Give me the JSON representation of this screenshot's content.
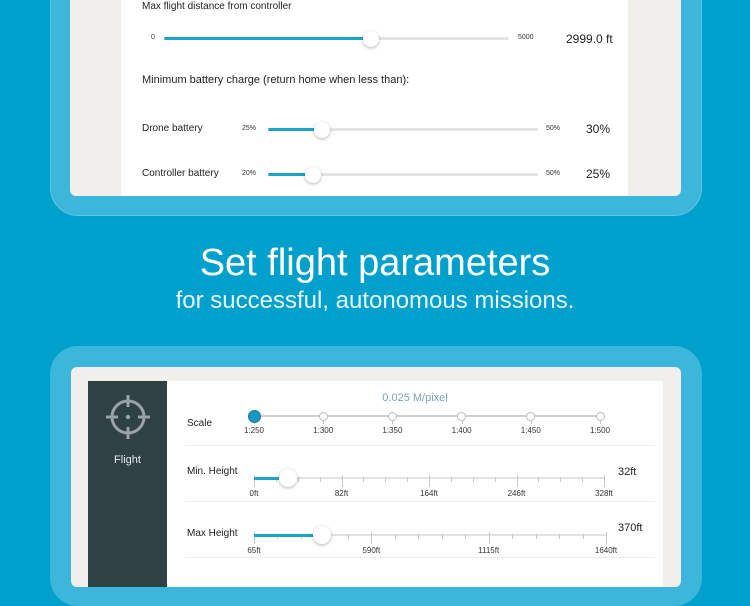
{
  "top_screen": {
    "max_distance": {
      "label": "Max flight distance from controller",
      "min_label": "0",
      "max_label": "5000",
      "min": 0,
      "max": 5000,
      "value": 2999,
      "value_text": "2999.0 ft"
    },
    "battery_heading": "Minimum battery charge (return home when less than):",
    "drone_battery": {
      "label": "Drone battery",
      "min_label": "25%",
      "max_label": "50%",
      "min": 25,
      "max": 50,
      "value": 30,
      "value_text": "30%"
    },
    "controller_battery": {
      "label": "Controller battery",
      "min_label": "20%",
      "max_label": "50%",
      "min": 20,
      "max": 50,
      "value": 25,
      "value_text": "25%"
    }
  },
  "headline": {
    "title": "Set flight parameters",
    "subtitle": "for successful, autonomous missions."
  },
  "bottom_screen": {
    "sidebar": {
      "icon": "crosshair-icon",
      "label": "Flight"
    },
    "scale": {
      "label": "Scale",
      "resolution_text": "0.025 M/pixel",
      "options": [
        "1:250",
        "1:300",
        "1:350",
        "1:400",
        "1:450",
        "1:500"
      ],
      "selected_index": 0
    },
    "min_height": {
      "label": "Min. Height",
      "tick_labels": [
        "0ft",
        "82ft",
        "164ft",
        "246ft",
        "328ft"
      ],
      "min": 0,
      "max": 328,
      "value": 32,
      "minor_per_major": 4,
      "value_text": "32ft"
    },
    "max_height": {
      "label": "Max Height",
      "tick_labels": [
        "65ft",
        "590ft",
        "1115ft",
        "1640ft"
      ],
      "min": 65,
      "max": 1640,
      "value": 370,
      "minor_per_major": 5,
      "value_text": "370ft"
    }
  },
  "colors": {
    "background": "#00a0cc",
    "accent": "#1aa6c9",
    "sidebar": "#2f4145"
  }
}
